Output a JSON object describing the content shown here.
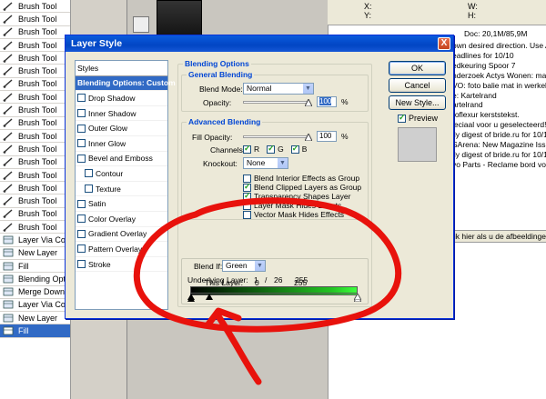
{
  "history": {
    "items": [
      {
        "label": "Brush Tool",
        "icon": "brush-icon"
      },
      {
        "label": "Brush Tool",
        "icon": "brush-icon"
      },
      {
        "label": "Brush Tool",
        "icon": "brush-icon"
      },
      {
        "label": "Brush Tool",
        "icon": "brush-icon"
      },
      {
        "label": "Brush Tool",
        "icon": "brush-icon"
      },
      {
        "label": "Brush Tool",
        "icon": "brush-icon"
      },
      {
        "label": "Brush Tool",
        "icon": "brush-icon"
      },
      {
        "label": "Brush Tool",
        "icon": "brush-icon"
      },
      {
        "label": "Brush Tool",
        "icon": "brush-icon"
      },
      {
        "label": "Brush Tool",
        "icon": "brush-icon"
      },
      {
        "label": "Brush Tool",
        "icon": "brush-icon"
      },
      {
        "label": "Brush Tool",
        "icon": "brush-icon"
      },
      {
        "label": "Brush Tool",
        "icon": "brush-icon"
      },
      {
        "label": "Brush Tool",
        "icon": "brush-icon"
      },
      {
        "label": "Brush Tool",
        "icon": "brush-icon"
      },
      {
        "label": "Brush Tool",
        "icon": "brush-icon"
      },
      {
        "label": "Brush Tool",
        "icon": "brush-icon"
      },
      {
        "label": "Brush Tool",
        "icon": "brush-icon"
      },
      {
        "label": "Layer Via Copy",
        "icon": "layer-icon"
      },
      {
        "label": "New Layer",
        "icon": "layer-icon"
      },
      {
        "label": "Fill",
        "icon": "layer-icon"
      },
      {
        "label": "Blending Options",
        "icon": "layer-icon"
      },
      {
        "label": "Merge Down",
        "icon": "layer-icon"
      },
      {
        "label": "Layer Via Copy",
        "icon": "layer-icon"
      },
      {
        "label": "New Layer",
        "icon": "layer-icon"
      },
      {
        "label": "Fill",
        "icon": "layer-icon",
        "selected": true
      }
    ]
  },
  "info_panel": {
    "x_label": "X:",
    "y_label": "Y:",
    "w_label": "W:",
    "h_label": "H:",
    "doc": "Doc: 20,1M/85,9M"
  },
  "browser_lines": [
    "own desired direction.  Use Alt and",
    "eadlines for 10/10",
    "edkeuring Spoor 7",
    "nderzoek Actys Wonen: maakt",
    "VO: foto balie mat in werkelijk",
    "e: Kartelrand",
    "artelrand",
    "roflexur kerststekst.",
    "ieciaal voor u geselecteerd!",
    "lly digest of bride.ru for 10/10",
    "SArena: New Magazine Issue",
    "lly digest of bride.ru for 10/10",
    "vo Parts - Reclame bord voor"
  ],
  "browser_bottom": "lik hier als u de afbeeldingen",
  "dialog": {
    "title": "Layer Style",
    "close_label": "X",
    "styles_header": "Styles",
    "styles": [
      {
        "label": "Blending Options: Custom",
        "active": true,
        "checkbox": false
      },
      {
        "label": "Drop Shadow",
        "checkbox": true
      },
      {
        "label": "Inner Shadow",
        "checkbox": true
      },
      {
        "label": "Outer Glow",
        "checkbox": true
      },
      {
        "label": "Inner Glow",
        "checkbox": true
      },
      {
        "label": "Bevel and Emboss",
        "checkbox": true
      },
      {
        "label": "Contour",
        "checkbox": true,
        "indent": true
      },
      {
        "label": "Texture",
        "checkbox": true,
        "indent": true
      },
      {
        "label": "Satin",
        "checkbox": true
      },
      {
        "label": "Color Overlay",
        "checkbox": true
      },
      {
        "label": "Gradient Overlay",
        "checkbox": true
      },
      {
        "label": "Pattern Overlay",
        "checkbox": true
      },
      {
        "label": "Stroke",
        "checkbox": true
      }
    ],
    "blending_options_title": "Blending Options",
    "general": {
      "title": "General Blending",
      "blend_mode_label": "Blend Mode:",
      "blend_mode_value": "Normal",
      "opacity_label": "Opacity:",
      "opacity_value": "100",
      "opacity_unit": "%",
      "opacity_level": 1.0
    },
    "advanced": {
      "title": "Advanced Blending",
      "fill_opacity_label": "Fill Opacity:",
      "fill_opacity_value": "100",
      "fill_opacity_unit": "%",
      "fill_opacity_level": 1.0,
      "channels_label": "Channels:",
      "channels": [
        {
          "label": "R",
          "checked": true
        },
        {
          "label": "G",
          "checked": true
        },
        {
          "label": "B",
          "checked": true
        }
      ],
      "knockout_label": "Knockout:",
      "knockout_value": "None",
      "options": [
        {
          "label": "Blend Interior Effects as Group",
          "checked": false
        },
        {
          "label": "Blend Clipped Layers as Group",
          "checked": true
        },
        {
          "label": "Transparency Shapes Layer",
          "checked": true
        },
        {
          "label": "Layer Mask Hides Effects",
          "checked": false
        },
        {
          "label": "Vector Mask Hides Effects",
          "checked": false
        }
      ]
    },
    "blend_if": {
      "label": "Blend If:",
      "value": "Green",
      "this_layer_label": "This Layer:",
      "this_layer_min": "0",
      "this_layer_max": "255",
      "underlying_label": "Underlying Layer:",
      "underlying_low": "1",
      "underlying_sep": "/",
      "underlying_high": "26",
      "underlying_max": "255"
    },
    "buttons": {
      "ok": "OK",
      "cancel": "Cancel",
      "new_style": "New Style...",
      "preview": "Preview",
      "preview_checked": true
    }
  },
  "colors": {
    "accent": "#316ac5",
    "title_blue": "#0046d5",
    "annotation": "#e8120c"
  }
}
